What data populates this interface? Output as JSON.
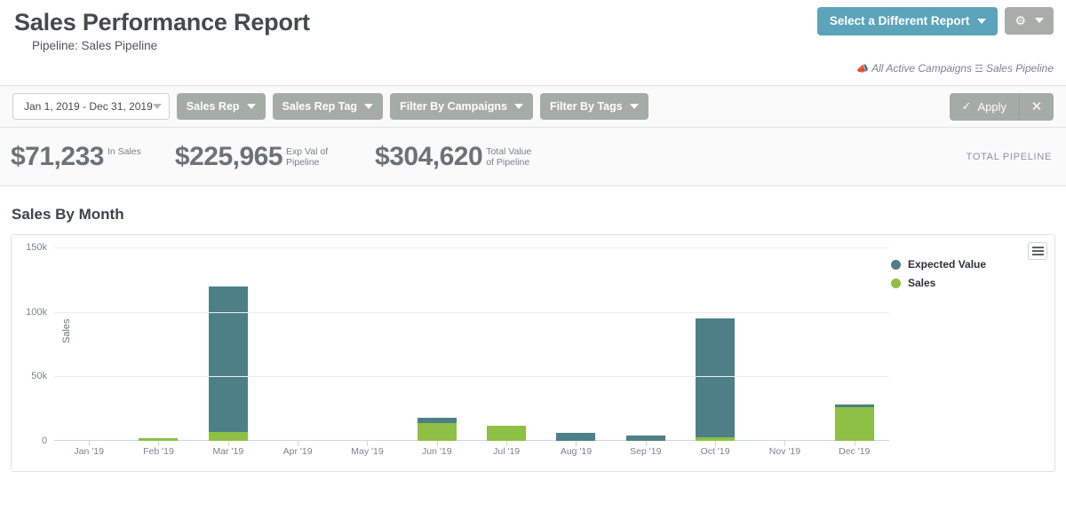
{
  "header": {
    "title": "Sales Performance Report",
    "subtitle": "Pipeline: Sales Pipeline",
    "select_report_label": "Select a Different Report",
    "gear_icon": "gear-icon",
    "caret_icon": "caret-down-icon",
    "breadcrumb": {
      "campaign_icon": "megaphone-icon",
      "campaign_text": "All Active Campaigns",
      "pipeline_icon": "pipeline-icon",
      "pipeline_text": "Sales Pipeline"
    }
  },
  "filters": {
    "date_range": "Jan 1, 2019 - Dec 31, 2019",
    "buttons": [
      {
        "label": "Sales Rep"
      },
      {
        "label": "Sales Rep Tag"
      },
      {
        "label": "Filter By Campaigns"
      },
      {
        "label": "Filter By Tags"
      }
    ],
    "apply_label": "Apply",
    "apply_icon": "check-icon",
    "clear_icon": "close-icon"
  },
  "kpis": [
    {
      "value": "$71,233",
      "label": "In Sales"
    },
    {
      "value": "$225,965",
      "label": "Exp Val of Pipeline"
    },
    {
      "value": "$304,620",
      "label": "Total Value of Pipeline"
    }
  ],
  "kpi_total_label": "TOTAL PIPELINE",
  "section": {
    "title": "Sales By Month",
    "menu_icon": "hamburger-menu-icon"
  },
  "colors": {
    "expected_value": "#4d8086",
    "sales": "#8dc044",
    "accent_button": "#5ba4bb",
    "filter_button": "#a5aba7"
  },
  "chart_data": {
    "type": "bar",
    "stacked": true,
    "title": "Sales By Month",
    "xlabel": "",
    "ylabel": "Sales",
    "ylim": [
      0,
      150000
    ],
    "yticks": [
      0,
      50000,
      100000,
      150000
    ],
    "ytick_labels": [
      "0",
      "50k",
      "100k",
      "150k"
    ],
    "grid": true,
    "legend_position": "right",
    "categories": [
      "Jan '19",
      "Feb '19",
      "Mar '19",
      "Apr '19",
      "May '19",
      "Jun '19",
      "Jul '19",
      "Aug '19",
      "Sep '19",
      "Oct '19",
      "Nov '19",
      "Dec '19"
    ],
    "series": [
      {
        "name": "Sales",
        "color": "#8dc044",
        "values": [
          0,
          2000,
          7000,
          0,
          0,
          14000,
          12000,
          0,
          0,
          3000,
          0,
          26000
        ]
      },
      {
        "name": "Expected Value",
        "color": "#4d8086",
        "values": [
          0,
          0,
          113000,
          0,
          0,
          4000,
          0,
          6000,
          4000,
          92000,
          0,
          2000
        ]
      }
    ]
  }
}
